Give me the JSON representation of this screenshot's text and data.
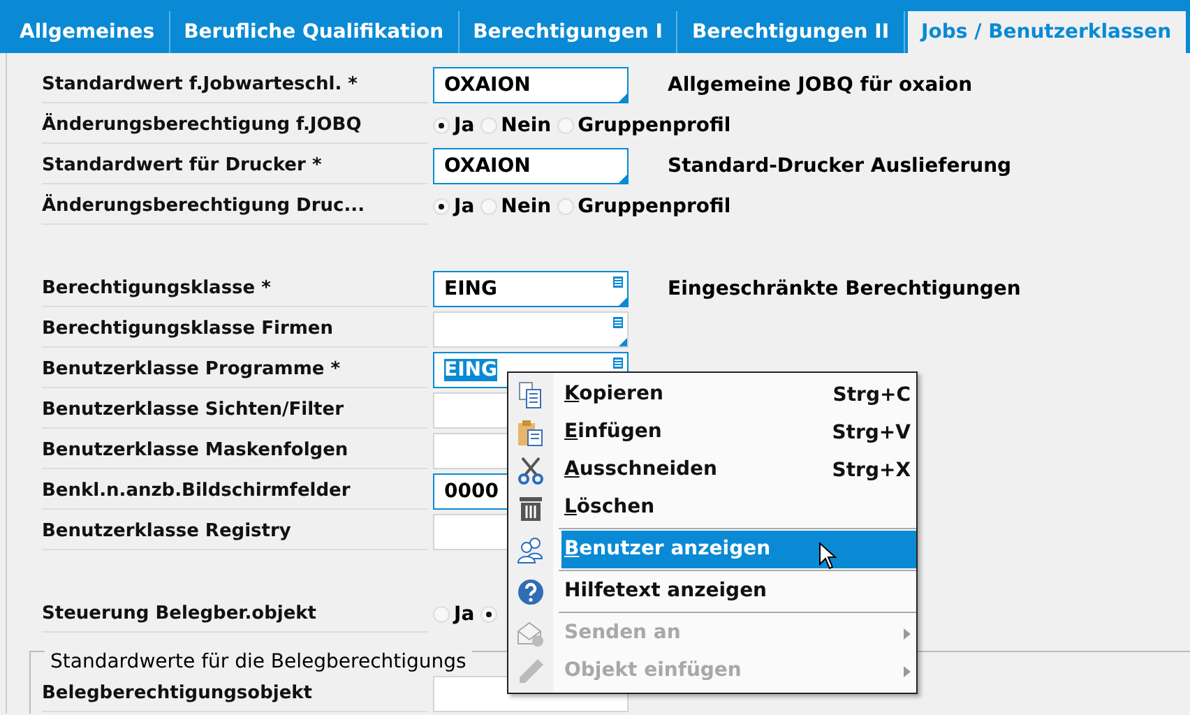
{
  "tabs": [
    {
      "label": "Allgemeines",
      "selected": false
    },
    {
      "label": "Berufliche Qualifikation",
      "selected": false
    },
    {
      "label": "Berechtigungen I",
      "selected": false
    },
    {
      "label": "Berechtigungen II",
      "selected": false
    },
    {
      "label": "Jobs / Benutzerklassen",
      "selected": true
    }
  ],
  "sections": [
    {
      "rows": [
        {
          "kind": "field",
          "label": "Standardwert f.Jobwarteschl. *",
          "value": "OXAION",
          "lookup": false,
          "focused": false,
          "description": "Allgemeine JOBQ für oxaion"
        },
        {
          "kind": "radio",
          "label": "Änderungsberechtigung f.JOBQ",
          "options": [
            {
              "label": "Ja",
              "selected": true
            },
            {
              "label": "Nein",
              "selected": false
            },
            {
              "label": "Gruppenprofil",
              "selected": false
            }
          ]
        },
        {
          "kind": "field",
          "label": "Standardwert für Drucker *",
          "value": "OXAION",
          "lookup": false,
          "focused": false,
          "description": "Standard-Drucker Auslieferung"
        },
        {
          "kind": "radio",
          "label": "Änderungsberechtigung Druc...",
          "options": [
            {
              "label": "Ja",
              "selected": true
            },
            {
              "label": "Nein",
              "selected": false
            },
            {
              "label": "Gruppenprofil",
              "selected": false
            }
          ]
        }
      ]
    },
    {
      "rows": [
        {
          "kind": "field",
          "label": "Berechtigungsklasse *",
          "value": "EING",
          "lookup": true,
          "focused": false,
          "description": "Eingeschränkte Berechtigungen"
        },
        {
          "kind": "field",
          "label": "Berechtigungsklasse Firmen",
          "lookup": true,
          "focused": false
        },
        {
          "kind": "field",
          "label": "Benutzerklasse Programme *",
          "value": "EING",
          "lookup": true,
          "focused": true
        },
        {
          "kind": "field",
          "label": "Benutzerklasse Sichten/Filter",
          "focused": false
        },
        {
          "kind": "field",
          "label": "Benutzerklasse Maskenfolgen",
          "focused": false
        },
        {
          "kind": "field",
          "label": "Benkl.n.anzb.Bildschirmfelder",
          "value": "0000",
          "focused": false
        },
        {
          "kind": "field",
          "label": "Benutzerklasse Registry",
          "focused": false
        }
      ]
    },
    {
      "rows": [
        {
          "kind": "radio",
          "label": "Steuerung Belegber.objekt",
          "options": [
            {
              "label": "Ja",
              "selected": false
            },
            {
              "selected": true
            }
          ]
        }
      ]
    }
  ],
  "group": {
    "title": "Standardwerte für die Belegberechtigungs",
    "rows": [
      {
        "kind": "field",
        "label": "Belegberechtigungsobjekt",
        "focused": false
      }
    ]
  },
  "context_menu": {
    "items": [
      {
        "label": "Kopieren",
        "mnemonic": true,
        "shortcut": "Strg+C",
        "selected": false,
        "disabled": false,
        "submenu": false
      },
      {
        "label": "Einfügen",
        "mnemonic": true,
        "shortcut": "Strg+V",
        "selected": false,
        "disabled": false,
        "submenu": false
      },
      {
        "label": "Ausschneiden",
        "mnemonic": true,
        "shortcut": "Strg+X",
        "selected": false,
        "disabled": false,
        "submenu": false
      },
      {
        "label": "Löschen",
        "mnemonic": true,
        "selected": false,
        "disabled": false,
        "submenu": false
      },
      {
        "kind": "separator"
      },
      {
        "label": "Benutzer anzeigen",
        "mnemonic": true,
        "selected": true,
        "disabled": false,
        "submenu": false
      },
      {
        "kind": "separator"
      },
      {
        "label": "Hilfetext anzeigen",
        "mnemonic": false,
        "selected": false,
        "disabled": false,
        "submenu": false
      },
      {
        "kind": "separator"
      },
      {
        "label": "Senden an",
        "mnemonic": false,
        "selected": false,
        "disabled": true,
        "submenu": true
      },
      {
        "label": "Objekt einfügen",
        "mnemonic": false,
        "selected": false,
        "disabled": true,
        "submenu": true
      }
    ]
  }
}
